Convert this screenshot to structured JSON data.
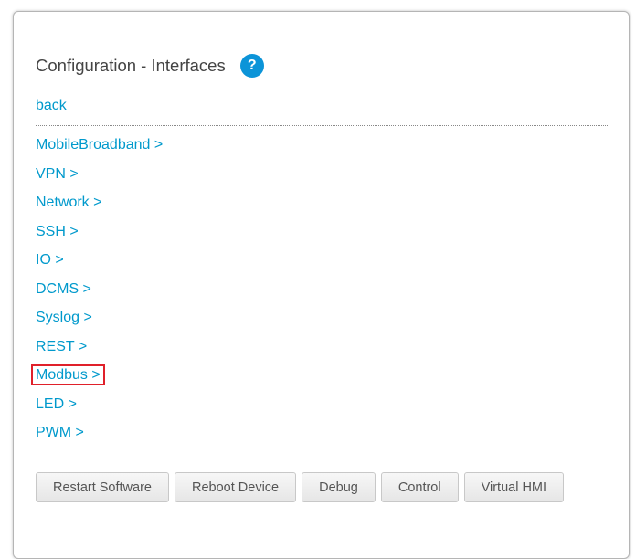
{
  "header": {
    "title": "Configuration - Interfaces",
    "help_icon": "question-circle-icon",
    "help_symbol": "?"
  },
  "nav": {
    "back_label": "back"
  },
  "menu": {
    "items": [
      {
        "label": "MobileBroadband >"
      },
      {
        "label": "VPN >"
      },
      {
        "label": "Network >"
      },
      {
        "label": "SSH >"
      },
      {
        "label": "IO >"
      },
      {
        "label": "DCMS >"
      },
      {
        "label": "Syslog >"
      },
      {
        "label": "REST >"
      },
      {
        "label": "Modbus >",
        "highlighted": true
      },
      {
        "label": "LED >"
      },
      {
        "label": "PWM >"
      }
    ]
  },
  "actions": {
    "restart_software": "Restart Software",
    "reboot_device": "Reboot Device",
    "debug": "Debug",
    "control": "Control",
    "virtual_hmi": "Virtual HMI"
  },
  "colors": {
    "link": "#0099cc",
    "accent": "#0c94d8",
    "highlight_border": "#e0202a"
  }
}
